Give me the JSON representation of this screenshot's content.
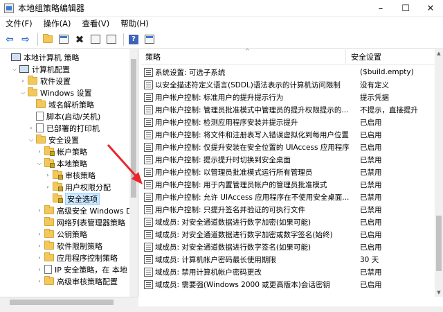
{
  "window": {
    "title": "本地组策略编辑器"
  },
  "menu": [
    "文件(F)",
    "操作(A)",
    "查看(V)",
    "帮助(H)"
  ],
  "tree": [
    {
      "label": "本地计算机 策略",
      "level": 0,
      "icon": "computer-policy-icon",
      "expander": ""
    },
    {
      "label": "计算机配置",
      "level": 1,
      "icon": "computer-icon",
      "expander": "v"
    },
    {
      "label": "软件设置",
      "level": 2,
      "icon": "folder-icon",
      "expander": ">"
    },
    {
      "label": "Windows 设置",
      "level": 2,
      "icon": "folder-icon",
      "expander": "v"
    },
    {
      "label": "域名解析策略",
      "level": 3,
      "icon": "folder-icon",
      "expander": ""
    },
    {
      "label": "脚本(启动/关机)",
      "level": 3,
      "icon": "script-icon",
      "expander": ""
    },
    {
      "label": "已部署的打印机",
      "level": 3,
      "icon": "printer-icon",
      "expander": ">"
    },
    {
      "label": "安全设置",
      "level": 3,
      "icon": "folder-icon",
      "expander": "v"
    },
    {
      "label": "帐户策略",
      "level": 4,
      "icon": "lock-folder-icon",
      "expander": ">"
    },
    {
      "label": "本地策略",
      "level": 4,
      "icon": "lock-folder-icon",
      "expander": "v"
    },
    {
      "label": "审核策略",
      "level": 5,
      "icon": "lock-folder-icon",
      "expander": ">"
    },
    {
      "label": "用户权限分配",
      "level": 5,
      "icon": "lock-folder-icon",
      "expander": ">"
    },
    {
      "label": "安全选项",
      "level": 5,
      "icon": "lock-folder-icon",
      "expander": "",
      "selected": true
    },
    {
      "label": "高级安全 Windows D",
      "level": 4,
      "icon": "folder-icon",
      "expander": ">"
    },
    {
      "label": "网络列表管理器策略",
      "level": 4,
      "icon": "folder-icon",
      "expander": ""
    },
    {
      "label": "公钥策略",
      "level": 4,
      "icon": "folder-icon",
      "expander": ">"
    },
    {
      "label": "软件限制策略",
      "level": 4,
      "icon": "folder-icon",
      "expander": ">"
    },
    {
      "label": "应用程序控制策略",
      "level": 4,
      "icon": "folder-icon",
      "expander": ">"
    },
    {
      "label": "IP 安全策略，在 本地",
      "level": 4,
      "icon": "ip-security-icon",
      "expander": ">"
    },
    {
      "label": "高级审核策略配置",
      "level": 4,
      "icon": "folder-icon",
      "expander": ">"
    }
  ],
  "columns": {
    "policy": "策略",
    "setting": "安全设置"
  },
  "policies": [
    {
      "name": "系统设置: 可选子系统",
      "value": "($build.empty)"
    },
    {
      "name": "以安全描述符定义语言(SDDL)语法表示的计算机访问限制",
      "value": "没有定义"
    },
    {
      "name": "用户帐户控制: 标准用户的提升提示行为",
      "value": "提示凭据"
    },
    {
      "name": "用户帐户控制: 管理员批准模式中管理员的提升权限提示的...",
      "value": "不提示，直接提升"
    },
    {
      "name": "用户帐户控制: 检测应用程序安装并提示提升",
      "value": "已启用"
    },
    {
      "name": "用户帐户控制: 将文件和注册表写入错误虚拟化到每用户位置",
      "value": "已启用"
    },
    {
      "name": "用户帐户控制: 仅提升安装在安全位置的 UIAccess 应用程序",
      "value": "已启用"
    },
    {
      "name": "用户帐户控制: 提示提升时切换到安全桌面",
      "value": "已禁用"
    },
    {
      "name": "用户帐户控制: 以管理员批准模式运行所有管理员",
      "value": "已禁用"
    },
    {
      "name": "用户帐户控制: 用于内置管理员帐户的管理员批准模式",
      "value": "已禁用"
    },
    {
      "name": "用户帐户控制: 允许 UIAccess 应用程序在不使用安全桌面...",
      "value": "已禁用"
    },
    {
      "name": "用户帐户控制: 只提升签名并验证的可执行文件",
      "value": "已禁用"
    },
    {
      "name": "域成员: 对安全通道数据进行数字加密(如果可能)",
      "value": "已启用"
    },
    {
      "name": "域成员: 对安全通道数据进行数字加密或数字签名(始终)",
      "value": "已启用"
    },
    {
      "name": "域成员: 对安全通道数据进行数字签名(如果可能)",
      "value": "已启用"
    },
    {
      "name": "域成员: 计算机帐户密码最长使用期限",
      "value": "30 天"
    },
    {
      "name": "域成员: 禁用计算机帐户密码更改",
      "value": "已禁用"
    },
    {
      "name": "域成员: 需要强(Windows 2000 或更高版本)会话密钥",
      "value": "已启用"
    }
  ]
}
